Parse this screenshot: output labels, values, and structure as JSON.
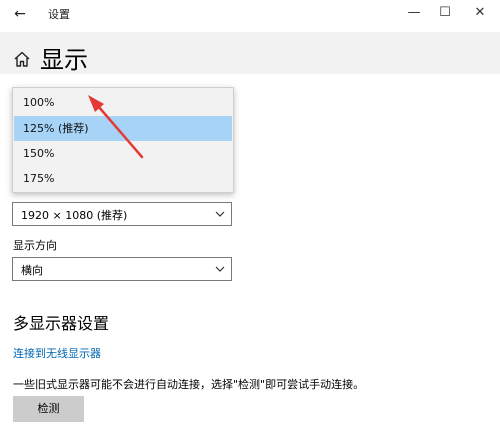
{
  "window": {
    "back_glyph": "←",
    "title": "设置",
    "minimize_glyph": "—",
    "maximize_glyph": "☐",
    "close_glyph": "✕"
  },
  "page": {
    "title": "显示"
  },
  "scale_dropdown": {
    "options": [
      "100%",
      "125% (推荐)",
      "150%",
      "175%"
    ],
    "selected_index": 1
  },
  "resolution": {
    "value": "1920 × 1080 (推荐)"
  },
  "orientation": {
    "label": "显示方向",
    "value": "横向"
  },
  "multi_display": {
    "title": "多显示器设置",
    "link": "连接到无线显示器",
    "description": "一些旧式显示器可能不会进行自动连接，选择\"检测\"即可尝试手动连接。",
    "detect_button": "检测"
  },
  "colors": {
    "accent_link": "#0066b4",
    "selected_item": "#a7d3f7",
    "annotation_arrow": "#e53935"
  }
}
